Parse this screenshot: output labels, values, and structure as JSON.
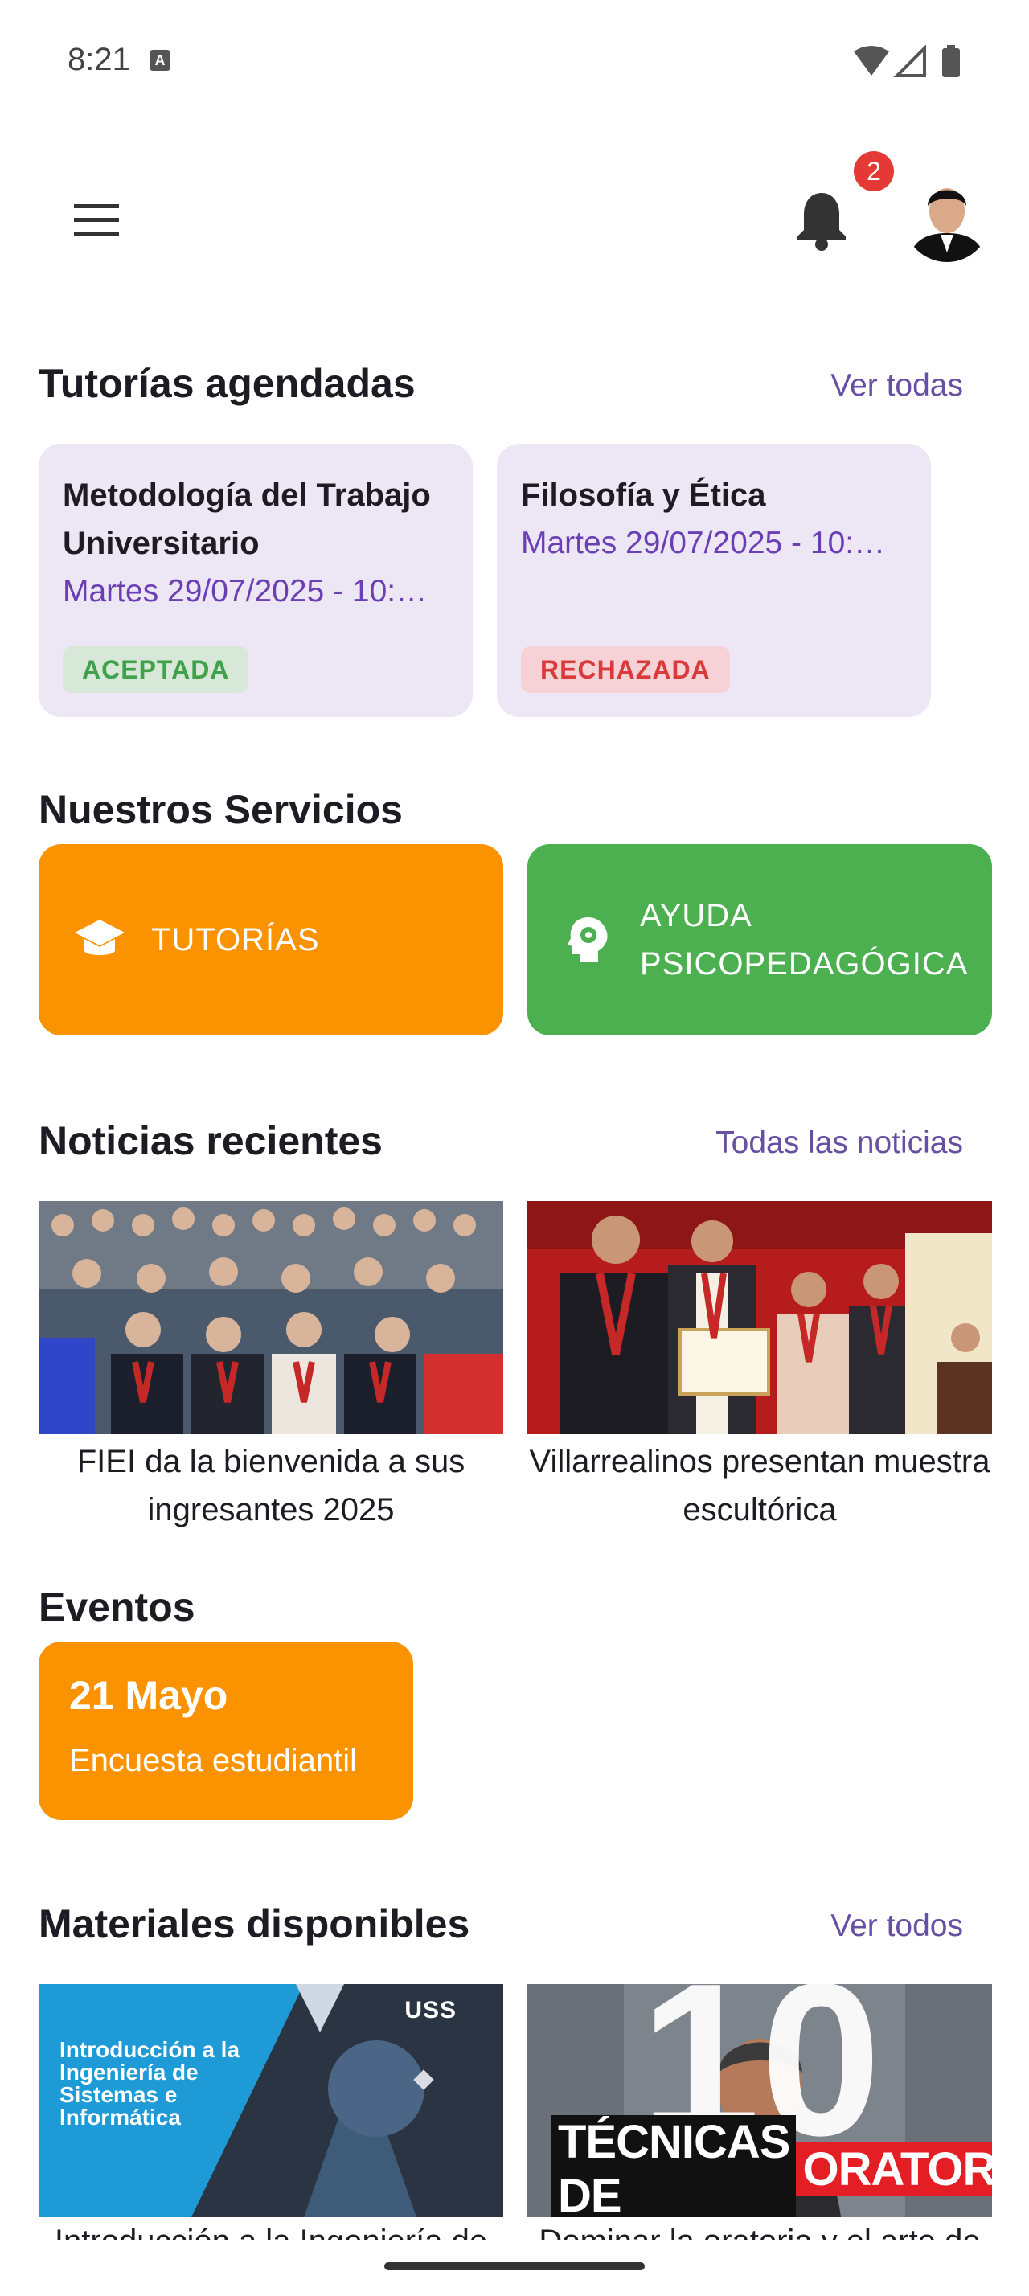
{
  "status_bar": {
    "time": "8:21",
    "notification_icon": "A"
  },
  "header": {
    "menu_icon": "hamburger-menu-icon",
    "notifications_count": "2"
  },
  "tutorias": {
    "title": "Tutorías agendadas",
    "link": "Ver todas",
    "cards": [
      {
        "title": "Metodología del Trabajo Universitario",
        "date": "Martes 29/07/2025 - 10:…",
        "status": "ACEPTADA"
      },
      {
        "title": "Filosofía y Ética",
        "date": "Martes 29/07/2025 - 10:…",
        "status": "RECHAZADA"
      }
    ]
  },
  "servicios": {
    "title": "Nuestros Servicios",
    "items": [
      {
        "label": "TUTORÍAS",
        "color": "#fb9300",
        "icon": "graduation-cap-icon"
      },
      {
        "label": "AYUDA PSICOPEDAGÓGICA",
        "color": "#4caf50",
        "icon": "head-gear-icon"
      }
    ]
  },
  "noticias": {
    "title": "Noticias recientes",
    "link": "Todas las noticias",
    "items": [
      {
        "caption": "FIEI da la bienvenida a sus ingresantes 2025"
      },
      {
        "caption": "Villarrealinos presentan muestra escultórica"
      }
    ]
  },
  "eventos": {
    "title": "Eventos",
    "items": [
      {
        "date": "21 Mayo",
        "name": "Encuesta estudiantil"
      }
    ]
  },
  "materiales": {
    "title": "Materiales disponibles",
    "link": "Ver todos",
    "items": [
      {
        "caption": "Introducción a la Ingeniería de Sistemas e Informática",
        "thumb_text": "Introducción a la Ingeniería de Sistemas e Informática",
        "thumb_brand": "USS"
      },
      {
        "caption": "Dominar la oratoria y el arte de hablar en público",
        "thumb_number": "10",
        "thumb_text_1": "TÉCNICAS DE",
        "thumb_text_2": "ORATORIA"
      }
    ]
  }
}
